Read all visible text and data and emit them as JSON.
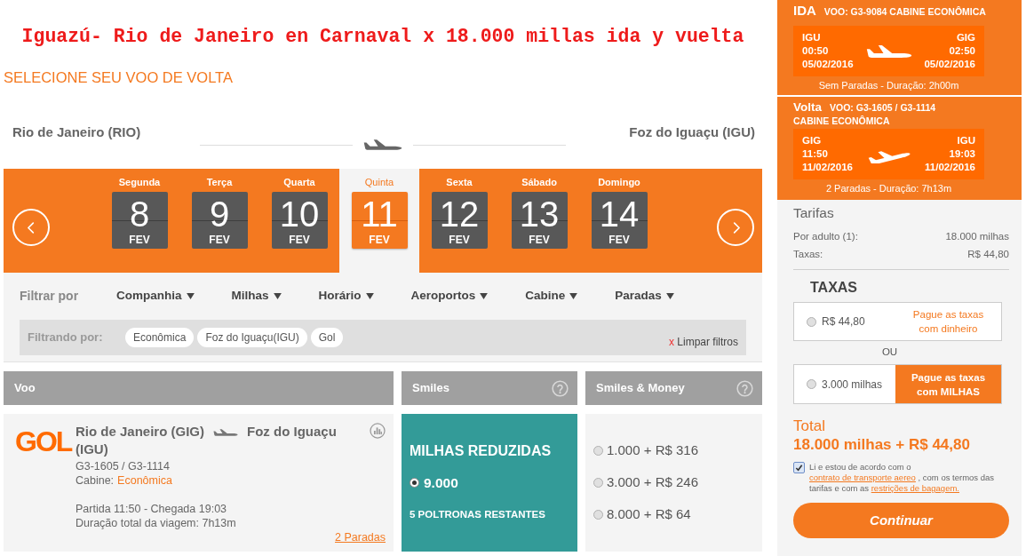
{
  "promo_title": "Iguazú- Rio de Janeiro en Carnaval x 18.000 millas ida y vuelta",
  "page_heading": "SELECIONE SEU VOO DE VOLTA",
  "route": {
    "origin": "Rio de Janeiro (RIO)",
    "destination": "Foz do Iguaçu (IGU)"
  },
  "date_selector": {
    "days": [
      {
        "weekday": "Segunda",
        "day": "8",
        "month": "FEV",
        "selected": false
      },
      {
        "weekday": "Terça",
        "day": "9",
        "month": "FEV",
        "selected": false
      },
      {
        "weekday": "Quarta",
        "day": "10",
        "month": "FEV",
        "selected": false
      },
      {
        "weekday": "Quinta",
        "day": "11",
        "month": "FEV",
        "selected": true
      },
      {
        "weekday": "Sexta",
        "day": "12",
        "month": "FEV",
        "selected": false
      },
      {
        "weekday": "Sábado",
        "day": "13",
        "month": "FEV",
        "selected": false
      },
      {
        "weekday": "Domingo",
        "day": "14",
        "month": "FEV",
        "selected": false
      }
    ]
  },
  "filters": {
    "label": "Filtrar por",
    "dropdowns": [
      "Companhia",
      "Milhas",
      "Horário",
      "Aeroportos",
      "Cabine",
      "Paradas"
    ],
    "applied": {
      "label": "Filtrando por:",
      "tags": [
        "Econômica",
        "Foz do Iguaçu(IGU)",
        "Gol"
      ],
      "clear_mark": "x",
      "clear_label": "Limpar filtros"
    }
  },
  "results": {
    "columns": [
      {
        "label": "Voo",
        "help": false
      },
      {
        "label": "Smiles",
        "help": true
      },
      {
        "label": "Smiles & Money",
        "help": true
      }
    ],
    "rows": [
      {
        "airline_logo": "GOL",
        "origin": "Rio de Janeiro (GIG)",
        "destination": "Foz do Iguaçu (IGU)",
        "flights": "G3-1605 / G3-1114",
        "cabin_label": "Cabine:",
        "cabin": "Econômica",
        "schedule": "Partida 11:50 - Chegada 19:03",
        "duration": "Duração total da viagem: 7h13m",
        "stops_link": "2 Paradas",
        "smiles": {
          "title": "MILHAS REDUZIDAS",
          "miles": "9.000",
          "selected": true,
          "seats_left": "5 POLTRONAS RESTANTES"
        },
        "smiles_money": [
          {
            "label": "1.000 + R$ 316",
            "selected": false
          },
          {
            "label": "3.000 + R$ 246",
            "selected": false
          },
          {
            "label": "8.000 + R$ 64",
            "selected": false
          }
        ]
      }
    ]
  },
  "itinerary": {
    "legs": [
      {
        "label": "IDA",
        "flight": "VOO: G3-9084 CABINE ECONÔMICA",
        "origin": {
          "code": "IGU",
          "time": "00:50",
          "date": "05/02/2016"
        },
        "destination": {
          "code": "GIG",
          "time": "02:50",
          "date": "05/02/2016"
        },
        "summary": "Sem Paradas - Duração: 2h00m"
      },
      {
        "label": "Volta",
        "flight": "VOO: G3-1605 / G3-1114",
        "cabin": "CABINE ECONÔMICA",
        "origin": {
          "code": "GIG",
          "time": "11:50",
          "date": "11/02/2016"
        },
        "destination": {
          "code": "IGU",
          "time": "19:03",
          "date": "11/02/2016"
        },
        "summary": "2 Paradas - Duração: 7h13m"
      }
    ]
  },
  "fares": {
    "title": "Tarifas",
    "rows": [
      {
        "label": "Por adulto (1):",
        "value": "18.000 milhas"
      },
      {
        "label": "Taxas:",
        "value": "R$ 44,80"
      }
    ]
  },
  "taxes": {
    "title": "TAXAS",
    "separator": "OU",
    "options": [
      {
        "amount": "R$ 44,80",
        "action": "Pague as taxas com dinheiro",
        "selected": false,
        "highlighted": false
      },
      {
        "amount": "3.000 milhas",
        "action": "Pague as taxas com MILHAS",
        "selected": false,
        "highlighted": true
      }
    ]
  },
  "total": {
    "label": "Total",
    "amount": "18.000 milhas + R$ 44,80"
  },
  "agreement": {
    "checked": true,
    "parts": [
      {
        "kind": "text",
        "text": "Li e estou de acordo com o "
      },
      {
        "kind": "link",
        "text": "contrato de transporte aereo"
      },
      {
        "kind": "text",
        "text": " , com os termos das tarifas e com as "
      },
      {
        "kind": "link",
        "text": "restrições de bagagem."
      }
    ]
  },
  "continue_button": "Continuar"
}
